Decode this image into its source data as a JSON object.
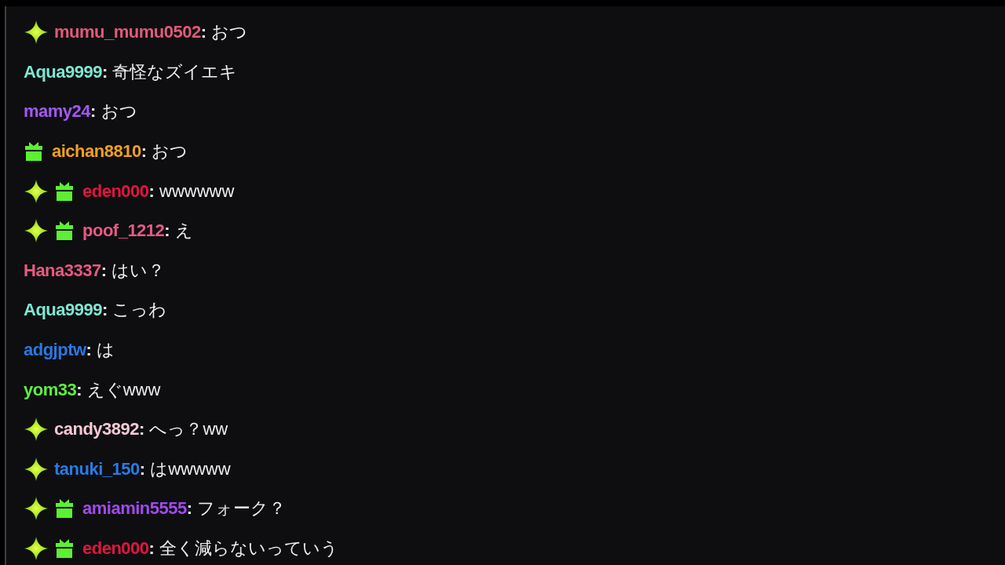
{
  "chat_messages": [
    {
      "badges": [
        {
          "kind": "sparkle"
        }
      ],
      "username": "mumu_mumu0502",
      "color": "#e05a7a",
      "message": "**:** おつ"
    },
    {
      "username": "Aqua9999",
      "color": "#7fe6d2",
      "message": "**:** 奇怪なズイエキ"
    },
    {
      "username": "mamy24",
      "color": "#a259f0",
      "message": "**:** おつ"
    },
    {
      "badges": [
        {
          "kind": "gift"
        }
      ],
      "username": "aichan8810",
      "color": "#f0a020",
      "message": "**:** おつ"
    },
    {
      "badges": [
        {
          "kind": "sparkle"
        },
        {
          "kind": "gift"
        }
      ],
      "username": "eden000",
      "color": "#e0163e",
      "message": "**:** wwwwww"
    },
    {
      "badges": [
        {
          "kind": "sparkle"
        },
        {
          "kind": "gift"
        }
      ],
      "username": "poof_1212",
      "color": "#e85a84",
      "message": "**:** え"
    },
    {
      "username": "Hana3337",
      "color": "#e85a80",
      "message": "**:** はい？"
    },
    {
      "username": "Aqua9999",
      "color": "#7fe6d2",
      "message": "**:** こっわ"
    },
    {
      "username": "adgjptw",
      "color": "#2a78e0",
      "message": "**:** は"
    },
    {
      "username": "yom33",
      "color": "#5ef040",
      "message": "**:** えぐwww"
    },
    {
      "badges": [
        {
          "kind": "sparkle"
        }
      ],
      "username": "candy3892",
      "color": "#f5c8d4",
      "message": "**:** へっ？ww"
    },
    {
      "badges": [
        {
          "kind": "sparkle"
        }
      ],
      "username": "tanuki_150",
      "color": "#2a7ae6",
      "message": "**:** はwwwww"
    },
    {
      "badges": [
        {
          "kind": "sparkle"
        },
        {
          "kind": "gift"
        }
      ],
      "username": "amiamin5555",
      "color": "#a04af0",
      "message": "**:** フォーク？"
    },
    {
      "badges": [
        {
          "kind": "sparkle"
        },
        {
          "kind": "gift"
        }
      ],
      "username": "eden000",
      "color": "#e0163e",
      "message": "**:** 全く減らないっていう"
    }
  ]
}
